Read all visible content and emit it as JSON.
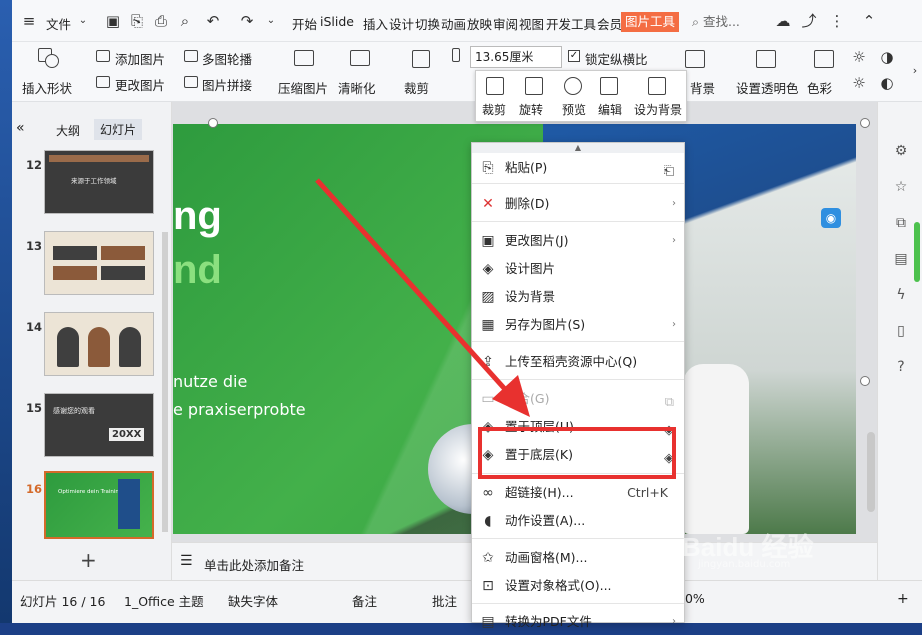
{
  "menu": {
    "file": "文件",
    "tabs": [
      "开始",
      "iSlide",
      "插入",
      "设计",
      "切换",
      "动画",
      "放映",
      "审阅",
      "视图",
      "开发工具",
      "会员专享"
    ],
    "picture_tools": "图片工具",
    "search": "查找..."
  },
  "ribbon": {
    "insert_shape": "插入形状",
    "add_picture": "添加图片",
    "change_picture": "更改图片",
    "multi_carousel": "多图轮播",
    "picture_collage": "图片拼接",
    "compress": "压缩图片",
    "sharpen": "清晰化",
    "crop": "裁剪",
    "size_value": "13.65厘米",
    "lock_ratio": "锁定纵横比",
    "set_background": "背景",
    "set_transparency": "设置透明色",
    "color": "色彩"
  },
  "floatbar": {
    "items": [
      "裁剪",
      "旋转",
      "预览",
      "编辑",
      "设为背景"
    ]
  },
  "leftpanel": {
    "outline": "大纲",
    "slides": "幻灯片",
    "thumbs": [
      {
        "num": "12",
        "title": "来源于工作领域"
      },
      {
        "num": "13",
        "title": ""
      },
      {
        "num": "14",
        "title": ""
      },
      {
        "num": "15",
        "title": "感谢您的观看",
        "year": "20XX"
      },
      {
        "num": "16",
        "title": "Optimiere dein Training"
      }
    ]
  },
  "slide": {
    "big1": "ng",
    "big2": "nd",
    "line1": "nutze die",
    "line2": "e praxiserprobte"
  },
  "notes": {
    "placeholder": "单击此处添加备注"
  },
  "status": {
    "slide_counter": "幻灯片 16 / 16",
    "theme": "1_Office 主题",
    "missing_font": "缺失字体",
    "notes": "备注",
    "comment": "批注",
    "zoom": "00%"
  },
  "context_menu": {
    "items": [
      {
        "label": "粘贴(P)"
      },
      {
        "label": "删除(D)"
      },
      {
        "label": "更改图片(J)"
      },
      {
        "label": "设计图片"
      },
      {
        "label": "设为背景"
      },
      {
        "label": "另存为图片(S)"
      },
      {
        "label": "上传至稻壳资源中心(Q)"
      },
      {
        "label": "组合(G)"
      },
      {
        "label": "置于顶层(U)"
      },
      {
        "label": "置于底层(K)"
      },
      {
        "label": "超链接(H)...",
        "shortcut": "Ctrl+K"
      },
      {
        "label": "动作设置(A)..."
      },
      {
        "label": "动画窗格(M)..."
      },
      {
        "label": "设置对象格式(O)..."
      },
      {
        "label": "转换为PDF文件"
      }
    ]
  },
  "watermark": {
    "text": "Baidu 经验",
    "url": "jingyan.baidu.com"
  },
  "colors": {
    "accent": "#f46d43",
    "highlight": "#e8312f",
    "slide_green": "#43b04a"
  }
}
